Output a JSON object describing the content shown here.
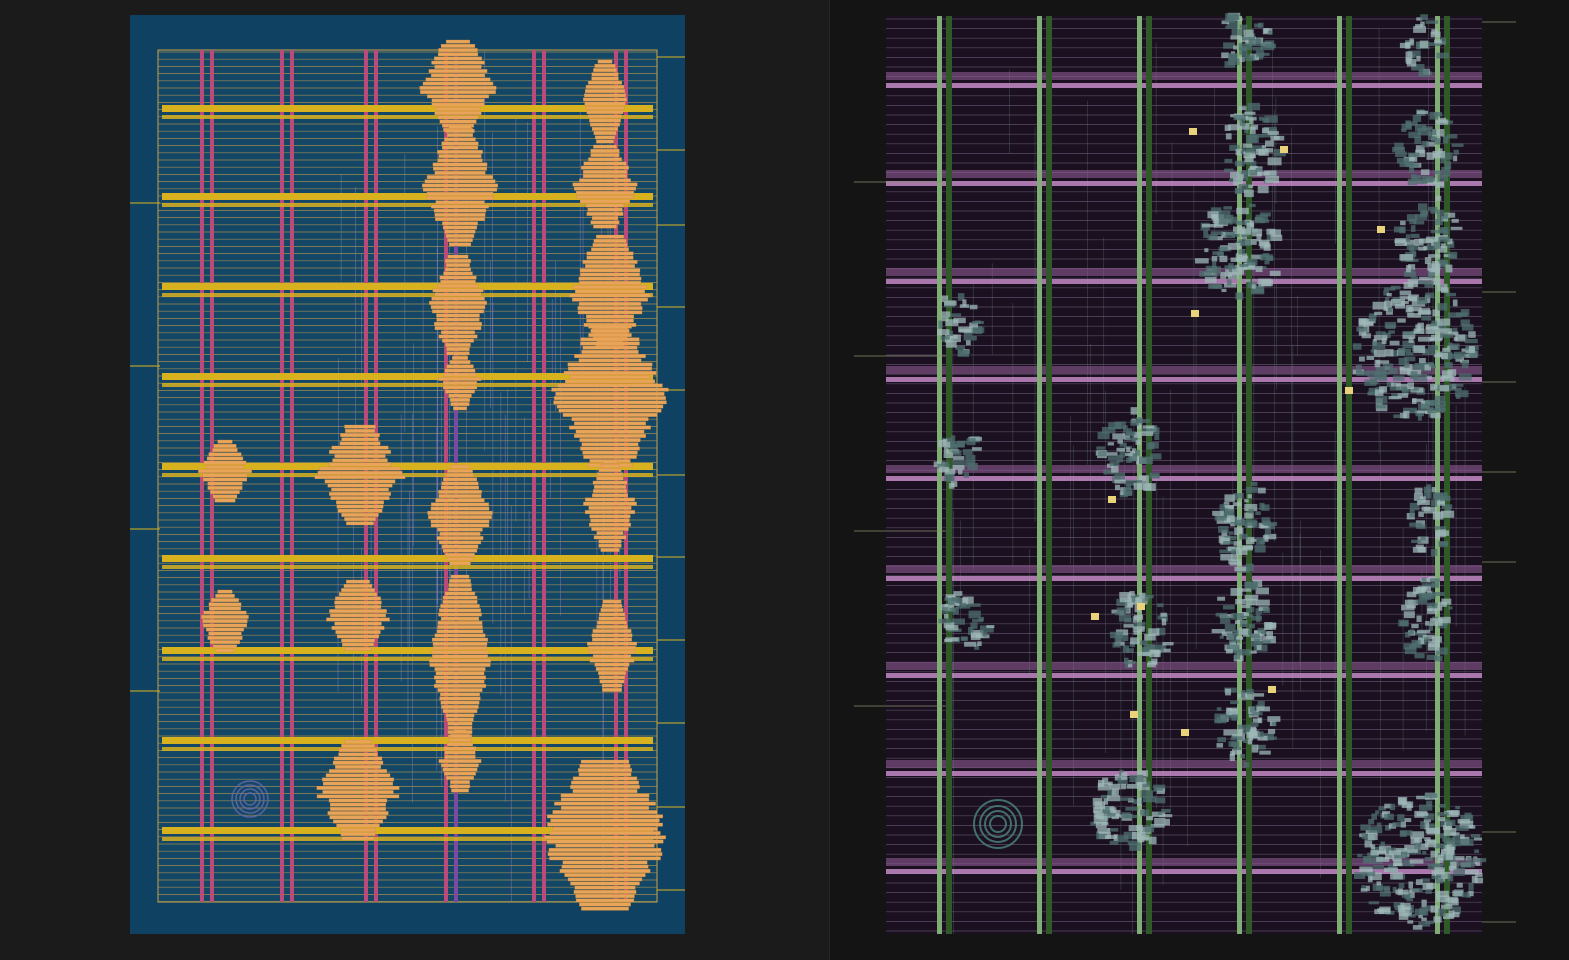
{
  "views": [
    {
      "id": "left",
      "style": "colored-layout",
      "colors": {
        "background": "#0f4262",
        "core": "#144766",
        "rail_thin": "#c9a24a",
        "rail_thick": "#d8b21e",
        "strap": "#b94a7a",
        "strap_dark": "#7a4aa0",
        "cell": "#e8a55a",
        "cell_edge": "#c98538",
        "wire": "#8a7fc8",
        "pin": "#d8b21e",
        "via_ring": "#6a6ab0"
      },
      "strap_count": 6,
      "thick_rail_count": 9,
      "cell_clusters": 16
    },
    {
      "id": "right",
      "style": "heatmap-layout",
      "colors": {
        "background": "#141414",
        "core": "#1a1020",
        "rail_thin": "#6a5a78",
        "rail_thick": "#8e5a92",
        "rail_thick_light": "#c38ac4",
        "strap": "#2f5a28",
        "strap_light": "#7fae74",
        "cell": "#4f6f6f",
        "cell_light": "#9fb8b8",
        "wire": "#5a6a6a",
        "highlight": "#e8d27a",
        "pin": "#8a8a6a",
        "via_ring": "#4a7f7a"
      },
      "strap_count": 6,
      "thick_rail_count": 9,
      "cell_clusters": 18
    }
  ]
}
